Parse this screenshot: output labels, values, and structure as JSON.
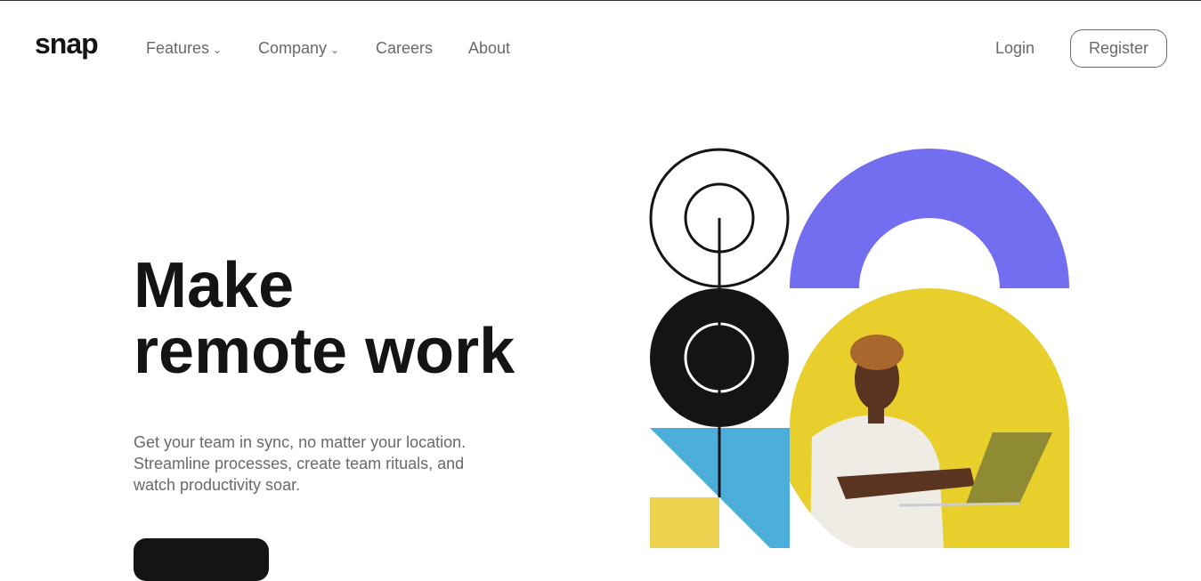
{
  "brand": "snap",
  "nav": {
    "items": [
      {
        "label": "Features",
        "dropdown": true
      },
      {
        "label": "Company",
        "dropdown": true
      },
      {
        "label": "Careers"
      },
      {
        "label": "About"
      }
    ],
    "login": "Login",
    "register": "Register",
    "chevron": "⌄"
  },
  "hero": {
    "title_line1": "Make",
    "title_line2": "remote work",
    "subtitle": "Get your team in sync, no matter your location. Streamline processes, create team rituals, and watch productivity soar."
  },
  "colors": {
    "purple": "#736def",
    "yellow": "#e8cf2c",
    "blue": "#4baedb",
    "black": "#141414"
  }
}
